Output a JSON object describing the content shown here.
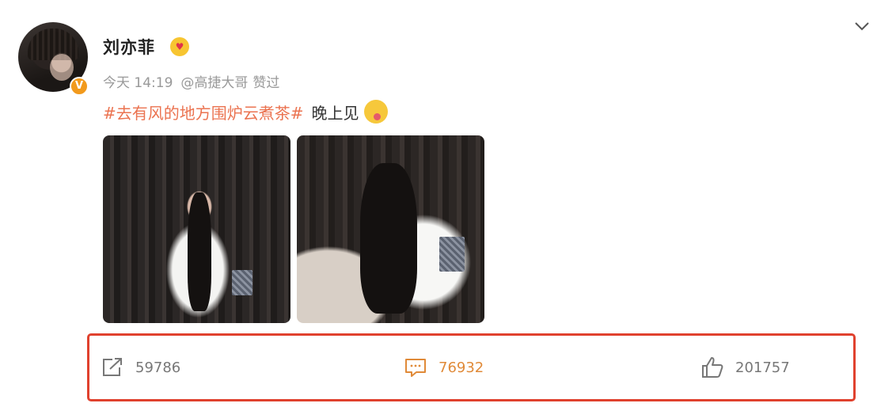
{
  "post": {
    "author": {
      "name": "刘亦菲",
      "verified_badge": "V"
    },
    "meta": {
      "time": "今天 14:19",
      "mention": "@高捷大哥",
      "liked_label": "赞过"
    },
    "content": {
      "hashtag": "#去有风的地方围炉云煮茶#",
      "text": "晚上见"
    },
    "images": [
      "photo-1",
      "photo-2"
    ],
    "actions": {
      "repost": {
        "count": "59786",
        "icon": "share-icon"
      },
      "comment": {
        "count": "76932",
        "icon": "comment-icon"
      },
      "like": {
        "count": "201757",
        "icon": "thumbs-up-icon"
      }
    }
  },
  "colors": {
    "hashtag": "#eb7350",
    "highlight_border": "#e0412e",
    "comment_active": "#e08a38",
    "verified": "#f29a1c"
  }
}
